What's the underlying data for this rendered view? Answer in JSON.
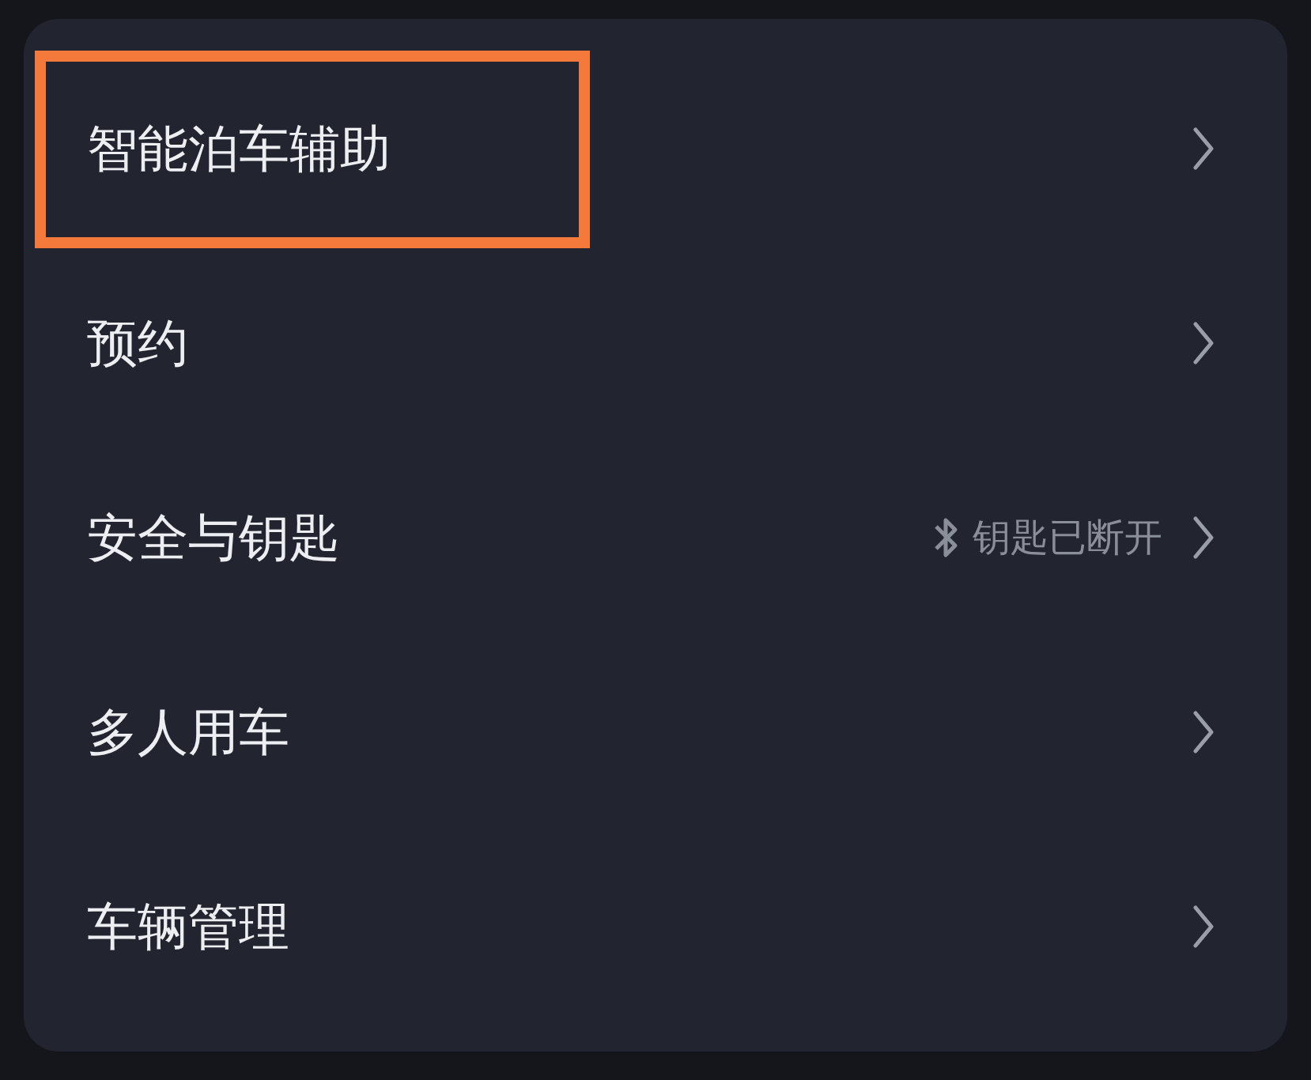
{
  "menu": [
    {
      "label": "智能泊车辅助",
      "highlighted": true
    },
    {
      "label": "预约",
      "highlighted": false
    },
    {
      "label": "安全与钥匙",
      "highlighted": false,
      "status": "钥匙已断开"
    },
    {
      "label": "多人用车",
      "highlighted": false
    },
    {
      "label": "车辆管理",
      "highlighted": false
    }
  ]
}
